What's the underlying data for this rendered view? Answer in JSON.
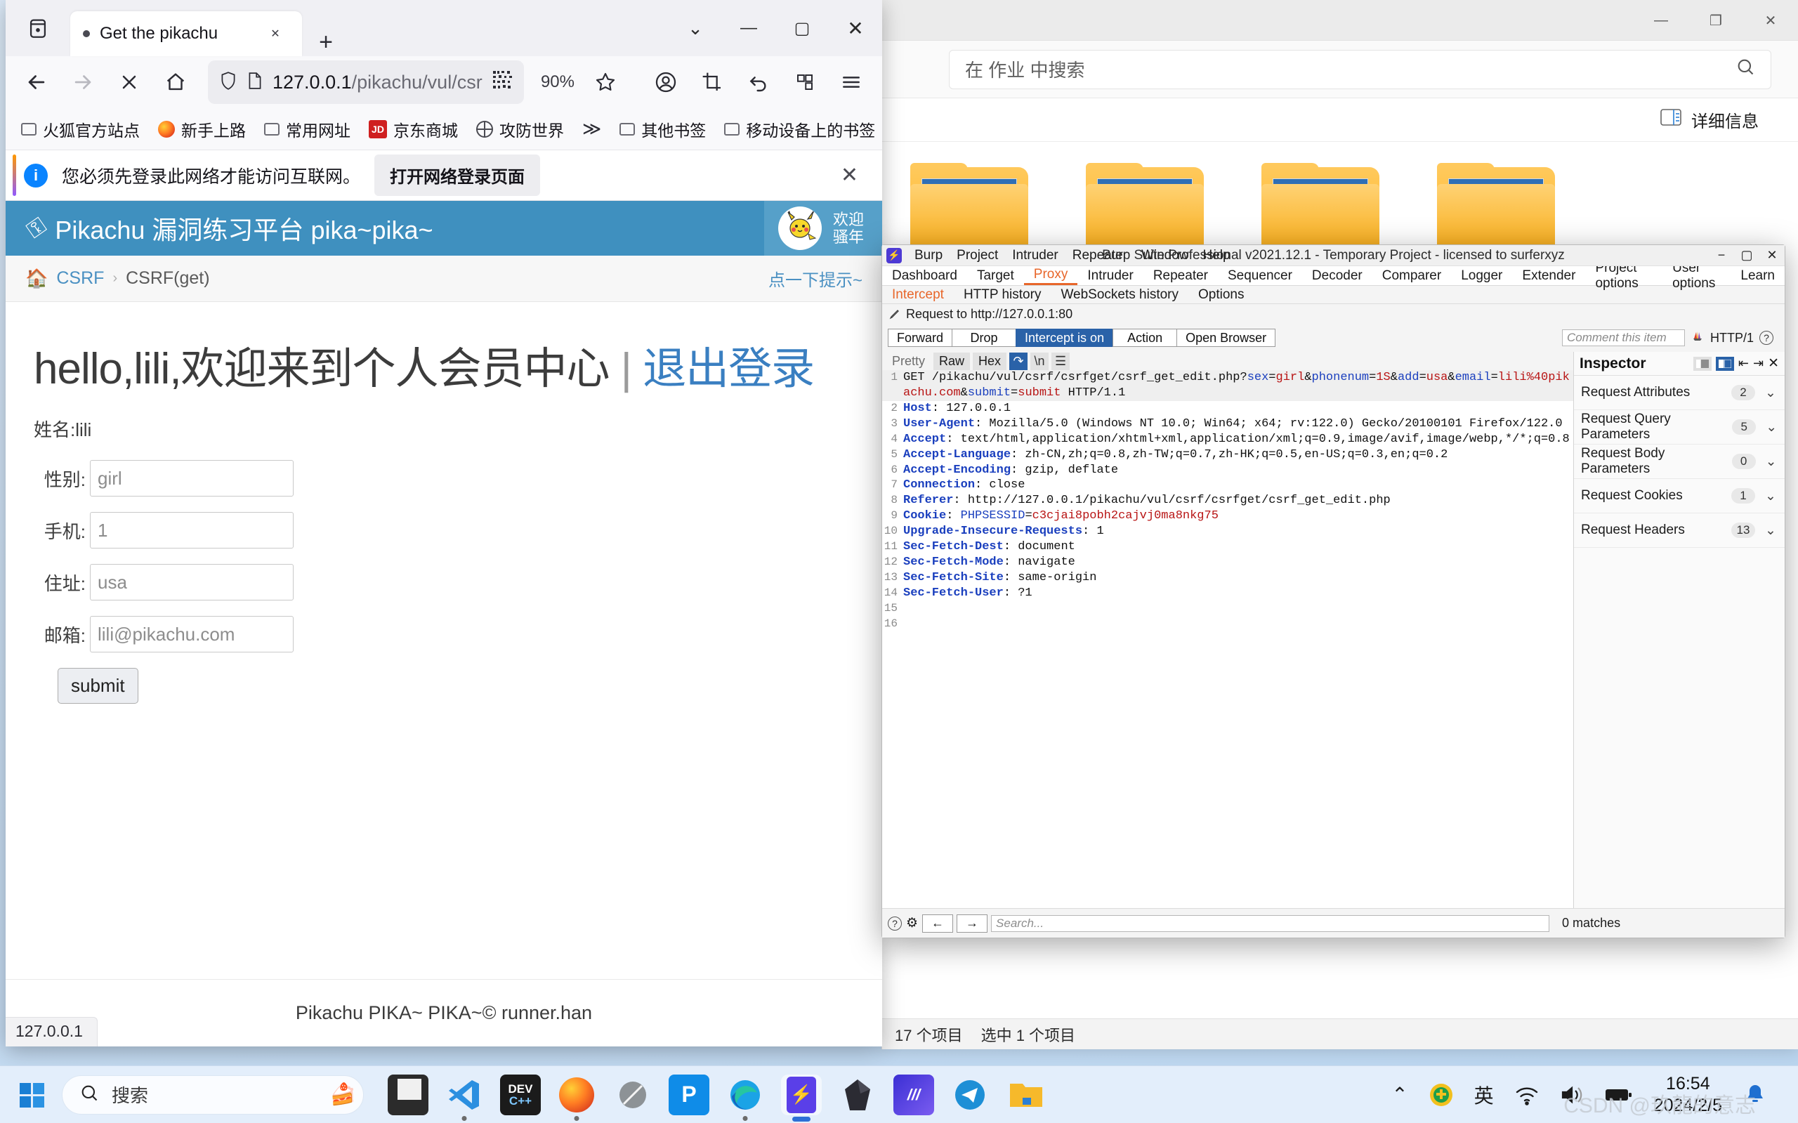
{
  "explorer": {
    "search_placeholder": "在 作业 中搜索",
    "details_label": "详细信息",
    "status_items": "17 个项目",
    "status_selected": "选中 1 个项目",
    "window_buttons": {
      "minimize": "—",
      "restore": "❐",
      "close": "✕"
    }
  },
  "firefox": {
    "tab": {
      "title": "Get the pikachu",
      "close": "✕"
    },
    "new_tab": "+",
    "list_all_tabs": "⌄",
    "window_buttons": {
      "minimize": "—",
      "maximize": "▢",
      "close": "✕"
    },
    "url": {
      "host": "127.0.0.1",
      "path": "/pikachu/vul/csr"
    },
    "zoom": "90%",
    "bookmarks": [
      {
        "label": "火狐官方站点",
        "icon": "folder-icon"
      },
      {
        "label": "新手上路",
        "icon": "firefox-icon"
      },
      {
        "label": "常用网址",
        "icon": "folder-icon"
      },
      {
        "label": "京东商城",
        "icon": "jd-icon"
      },
      {
        "label": "攻防世界",
        "icon": "globe-icon"
      },
      {
        "label": "其他书签",
        "icon": "folder-icon"
      },
      {
        "label": "移动设备上的书签",
        "icon": "folder-icon"
      }
    ],
    "bookmarks_overflow": "≫",
    "notification": {
      "text": "您必须先登录此网络才能访问互联网。",
      "button": "打开网络登录页面",
      "close": "✕",
      "info_glyph": "i"
    },
    "status_text": "127.0.0.1"
  },
  "pikachu": {
    "brand": "Pikachu 漏洞练习平台 pika~pika~",
    "welcome_line1": "欢迎",
    "welcome_line2": "骚年",
    "breadcrumb": {
      "home_icon": "home-icon",
      "root": "CSRF",
      "sep": "›",
      "current": "CSRF(get)"
    },
    "hint": "点一下提示~",
    "hello": "hello,lili,欢迎来到个人会员中心",
    "pipe": "|",
    "logout": "退出登录",
    "name_row": "姓名:lili",
    "fields": [
      {
        "label": "性别:",
        "value": "girl"
      },
      {
        "label": "手机:",
        "value": "1"
      },
      {
        "label": "住址:",
        "value": "usa"
      },
      {
        "label": "邮箱:",
        "value": "lili@pikachu.com"
      }
    ],
    "submit": "submit",
    "footer": "Pikachu PIKA~ PIKA~© runner.han"
  },
  "burp": {
    "app_title": "Burp Suite Professional v2021.12.1 - Temporary Project - licensed to surferxyz",
    "menu": [
      "Burp",
      "Project",
      "Intruder",
      "Repeater",
      "Window",
      "Help"
    ],
    "window_buttons": {
      "minimize": "−",
      "maximize": "▢",
      "close": "✕"
    },
    "tabs": [
      "Dashboard",
      "Target",
      "Proxy",
      "Intruder",
      "Repeater",
      "Sequencer",
      "Decoder",
      "Comparer",
      "Logger",
      "Extender",
      "Project options",
      "User options",
      "Learn"
    ],
    "active_tab": "Proxy",
    "subtabs": [
      "Intercept",
      "HTTP history",
      "WebSockets history",
      "Options"
    ],
    "active_subtab": "Intercept",
    "request_info": "Request to http://127.0.0.1:80",
    "actions": [
      "Forward",
      "Drop",
      "Intercept is on",
      "Action",
      "Open Browser"
    ],
    "active_action": "Intercept is on",
    "comment_placeholder": "Comment this item",
    "http_version": "HTTP/1",
    "help_glyph": "?",
    "view_tabs": [
      "Pretty",
      "Raw",
      "Hex"
    ],
    "active_view_tab": "Raw",
    "request_lines": [
      {
        "n": "1",
        "parts": [
          {
            "t": "GET /pikachu/vul/csrf/csrfget/csrf_get_edit.php?",
            "c": "plain"
          },
          {
            "t": "sex",
            "c": "blue"
          },
          {
            "t": "=",
            "c": "plain"
          },
          {
            "t": "girl",
            "c": "red"
          },
          {
            "t": "&",
            "c": "plain"
          },
          {
            "t": "phonenum",
            "c": "blue"
          },
          {
            "t": "=",
            "c": "plain"
          },
          {
            "t": "1S",
            "c": "red"
          },
          {
            "t": "&",
            "c": "plain"
          },
          {
            "t": "add",
            "c": "blue"
          },
          {
            "t": "=",
            "c": "plain"
          },
          {
            "t": "usa",
            "c": "red"
          },
          {
            "t": "&",
            "c": "plain"
          },
          {
            "t": "email",
            "c": "blue"
          },
          {
            "t": "=",
            "c": "plain"
          },
          {
            "t": "lili%40pikachu.com",
            "c": "red"
          },
          {
            "t": "&",
            "c": "plain"
          },
          {
            "t": "submit",
            "c": "blue"
          },
          {
            "t": "=",
            "c": "plain"
          },
          {
            "t": "submit",
            "c": "red"
          },
          {
            "t": " HTTP/1.1",
            "c": "plain"
          }
        ]
      },
      {
        "n": "2",
        "parts": [
          {
            "t": "Host",
            "c": "hdr"
          },
          {
            "t": ": 127.0.0.1",
            "c": "plain"
          }
        ]
      },
      {
        "n": "3",
        "parts": [
          {
            "t": "User-Agent",
            "c": "hdr"
          },
          {
            "t": ": Mozilla/5.0 (Windows NT 10.0; Win64; x64; rv:122.0) Gecko/20100101 Firefox/122.0",
            "c": "plain"
          }
        ]
      },
      {
        "n": "4",
        "parts": [
          {
            "t": "Accept",
            "c": "hdr"
          },
          {
            "t": ": text/html,application/xhtml+xml,application/xml;q=0.9,image/avif,image/webp,*/*;q=0.8",
            "c": "plain"
          }
        ]
      },
      {
        "n": "5",
        "parts": [
          {
            "t": "Accept-Language",
            "c": "hdr"
          },
          {
            "t": ": zh-CN,zh;q=0.8,zh-TW;q=0.7,zh-HK;q=0.5,en-US;q=0.3,en;q=0.2",
            "c": "plain"
          }
        ]
      },
      {
        "n": "6",
        "parts": [
          {
            "t": "Accept-Encoding",
            "c": "hdr"
          },
          {
            "t": ": gzip, deflate",
            "c": "plain"
          }
        ]
      },
      {
        "n": "7",
        "parts": [
          {
            "t": "Connection",
            "c": "hdr"
          },
          {
            "t": ": close",
            "c": "plain"
          }
        ]
      },
      {
        "n": "8",
        "parts": [
          {
            "t": "Referer",
            "c": "hdr"
          },
          {
            "t": ": http://127.0.0.1/pikachu/vul/csrf/csrfget/csrf_get_edit.php",
            "c": "plain"
          }
        ]
      },
      {
        "n": "9",
        "parts": [
          {
            "t": "Cookie",
            "c": "hdr"
          },
          {
            "t": ": ",
            "c": "plain"
          },
          {
            "t": "PHPSESSID",
            "c": "blue"
          },
          {
            "t": "=",
            "c": "plain"
          },
          {
            "t": "c3cjai8pobh2cajvj0ma8nkg75",
            "c": "red"
          }
        ]
      },
      {
        "n": "10",
        "parts": [
          {
            "t": "Upgrade-Insecure-Requests",
            "c": "hdr"
          },
          {
            "t": ": 1",
            "c": "plain"
          }
        ]
      },
      {
        "n": "11",
        "parts": [
          {
            "t": "Sec-Fetch-Dest",
            "c": "hdr"
          },
          {
            "t": ": document",
            "c": "plain"
          }
        ]
      },
      {
        "n": "12",
        "parts": [
          {
            "t": "Sec-Fetch-Mode",
            "c": "hdr"
          },
          {
            "t": ": navigate",
            "c": "plain"
          }
        ]
      },
      {
        "n": "13",
        "parts": [
          {
            "t": "Sec-Fetch-Site",
            "c": "hdr"
          },
          {
            "t": ": same-origin",
            "c": "plain"
          }
        ]
      },
      {
        "n": "14",
        "parts": [
          {
            "t": "Sec-Fetch-User",
            "c": "hdr"
          },
          {
            "t": ": ?1",
            "c": "plain"
          }
        ]
      },
      {
        "n": "15",
        "parts": []
      },
      {
        "n": "16",
        "parts": []
      }
    ],
    "inspector": {
      "title": "Inspector",
      "close": "✕",
      "rows": [
        {
          "label": "Request Attributes",
          "count": "2"
        },
        {
          "label": "Request Query Parameters",
          "count": "5"
        },
        {
          "label": "Request Body Parameters",
          "count": "0"
        },
        {
          "label": "Request Cookies",
          "count": "1"
        },
        {
          "label": "Request Headers",
          "count": "13"
        }
      ]
    },
    "footer": {
      "search_placeholder": "Search...",
      "matches": "0 matches",
      "help_glyph": "?",
      "gear_glyph": "⚙",
      "prev_glyph": "←",
      "next_glyph": "→"
    }
  },
  "taskbar": {
    "start_label": "start-icon",
    "search_placeholder": "搜索",
    "apps": [
      {
        "name": "file-explorer-light-icon",
        "glyph": "▮"
      },
      {
        "name": "vscode-icon",
        "glyph": "✕"
      },
      {
        "name": "devcpp-icon",
        "glyph": "DEV"
      },
      {
        "name": "firefox-icon",
        "glyph": "◍"
      },
      {
        "name": "snipaste-icon",
        "glyph": "∅"
      },
      {
        "name": "pycharm-icon",
        "glyph": "P"
      },
      {
        "name": "edge-icon",
        "glyph": "◒"
      },
      {
        "name": "burp-suite-icon",
        "glyph": "⚡"
      },
      {
        "name": "obsidian-icon",
        "glyph": "◆"
      },
      {
        "name": "navicat-icon",
        "glyph": "///"
      },
      {
        "name": "telegram-icon",
        "glyph": "➤"
      },
      {
        "name": "folder-icon",
        "glyph": "🗀"
      }
    ],
    "tray": {
      "chevron": "⌃",
      "antivirus": "✚",
      "ime": "英",
      "wifi": "wifi-icon",
      "volume": "volume-icon",
      "battery": "battery-icon"
    },
    "time": "16:54",
    "date": "2024/2/5",
    "notification_bell": "bell-icon"
  },
  "watermark": "CSDN @玖龍的意志"
}
